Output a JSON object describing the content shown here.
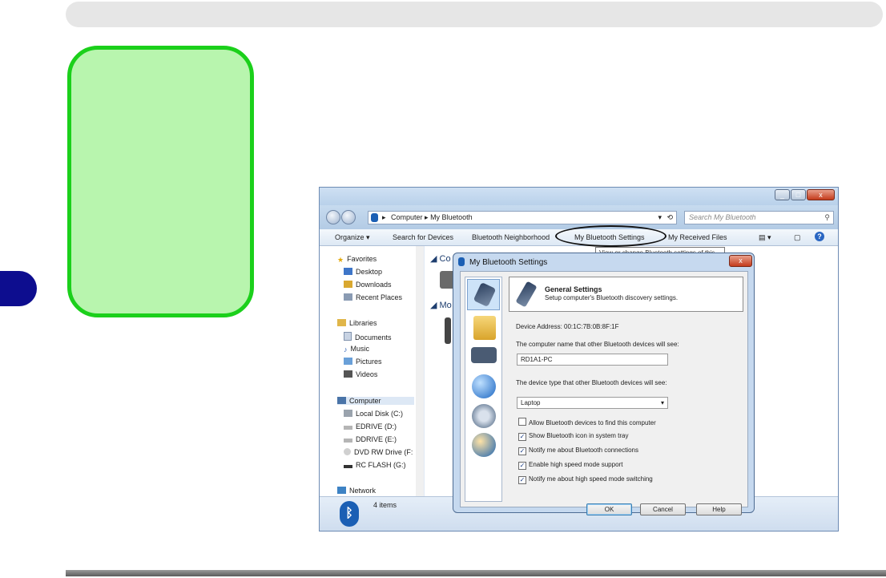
{
  "explorer": {
    "address": [
      "Computer",
      "My Bluetooth"
    ],
    "search_placeholder": "Search My Bluetooth",
    "toolbar": {
      "organize": "Organize ▾",
      "search_devices": "Search for Devices",
      "neighborhood": "Bluetooth Neighborhood",
      "my_settings": "My Bluetooth Settings",
      "received_files": "My Received Files"
    },
    "tooltip": "View or change Bluetooth settings of this computer",
    "nav": {
      "favorites": "Favorites",
      "desktop": "Desktop",
      "downloads": "Downloads",
      "recent": "Recent Places",
      "libraries": "Libraries",
      "documents": "Documents",
      "music": "Music",
      "pictures": "Pictures",
      "videos": "Videos",
      "computer": "Computer",
      "local_disk": "Local Disk (C:)",
      "edrive": "EDRIVE (D:)",
      "ddrive": "DDRIVE (E:)",
      "dvd": "DVD RW Drive (F:",
      "rcflash": "RC FLASH (G:)",
      "network": "Network"
    },
    "content": {
      "group1": "Co",
      "group2": "Mo"
    },
    "status": "4 items"
  },
  "dialog": {
    "title": "My Bluetooth Settings",
    "close": "x",
    "header_title": "General Settings",
    "header_sub": "Setup computer's Bluetooth discovery settings.",
    "device_address": "Device Address:   00:1C:7B:0B:8F:1F",
    "name_label": "The computer name that other Bluetooth devices will see:",
    "name_value": "RD1A1-PC",
    "type_label": "The device type that other Bluetooth devices will see:",
    "type_value": "Laptop",
    "options": [
      {
        "label": "Allow Bluetooth devices to find this computer",
        "checked": false
      },
      {
        "label": "Show Bluetooth icon in system tray",
        "checked": true
      },
      {
        "label": "Notify me about Bluetooth connections",
        "checked": true
      },
      {
        "label": "Enable high speed mode support",
        "checked": true
      },
      {
        "label": "Notify me about high speed mode switching",
        "checked": true
      }
    ],
    "ok": "OK",
    "cancel": "Cancel",
    "help": "Help"
  },
  "colors": {
    "green_fill": "#b8f5ae",
    "green_border": "#1bd01b",
    "chapter_tab": "#0d0d8f"
  }
}
